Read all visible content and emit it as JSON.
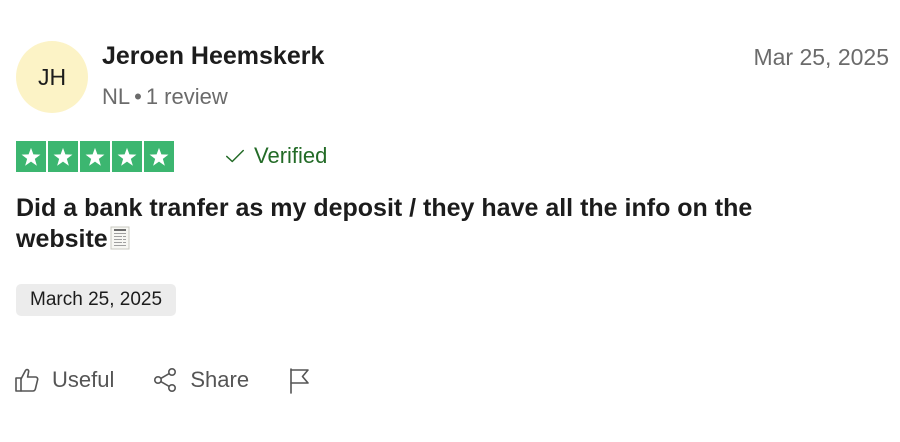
{
  "reviewer": {
    "initials": "JH",
    "avatar_color": "#fcf3c6",
    "name": "Jeroen Heemskerk",
    "country": "NL",
    "separator": "•",
    "review_count": "1 review"
  },
  "review": {
    "date": "Mar 25, 2025",
    "rating": 5,
    "rating_max": 5,
    "star_color": "#3cb670",
    "verified_label": "Verified",
    "verified_color": "#236b27",
    "text": "Did a bank tranfer as my deposit / they have all the info on the website",
    "emoji_icon": "receipt-icon",
    "experience_date": "March 25, 2025"
  },
  "actions": {
    "useful_label": "Useful",
    "useful_icon": "thumbs-up-icon",
    "share_label": "Share",
    "share_icon": "share-icon",
    "report_icon": "flag-icon"
  }
}
